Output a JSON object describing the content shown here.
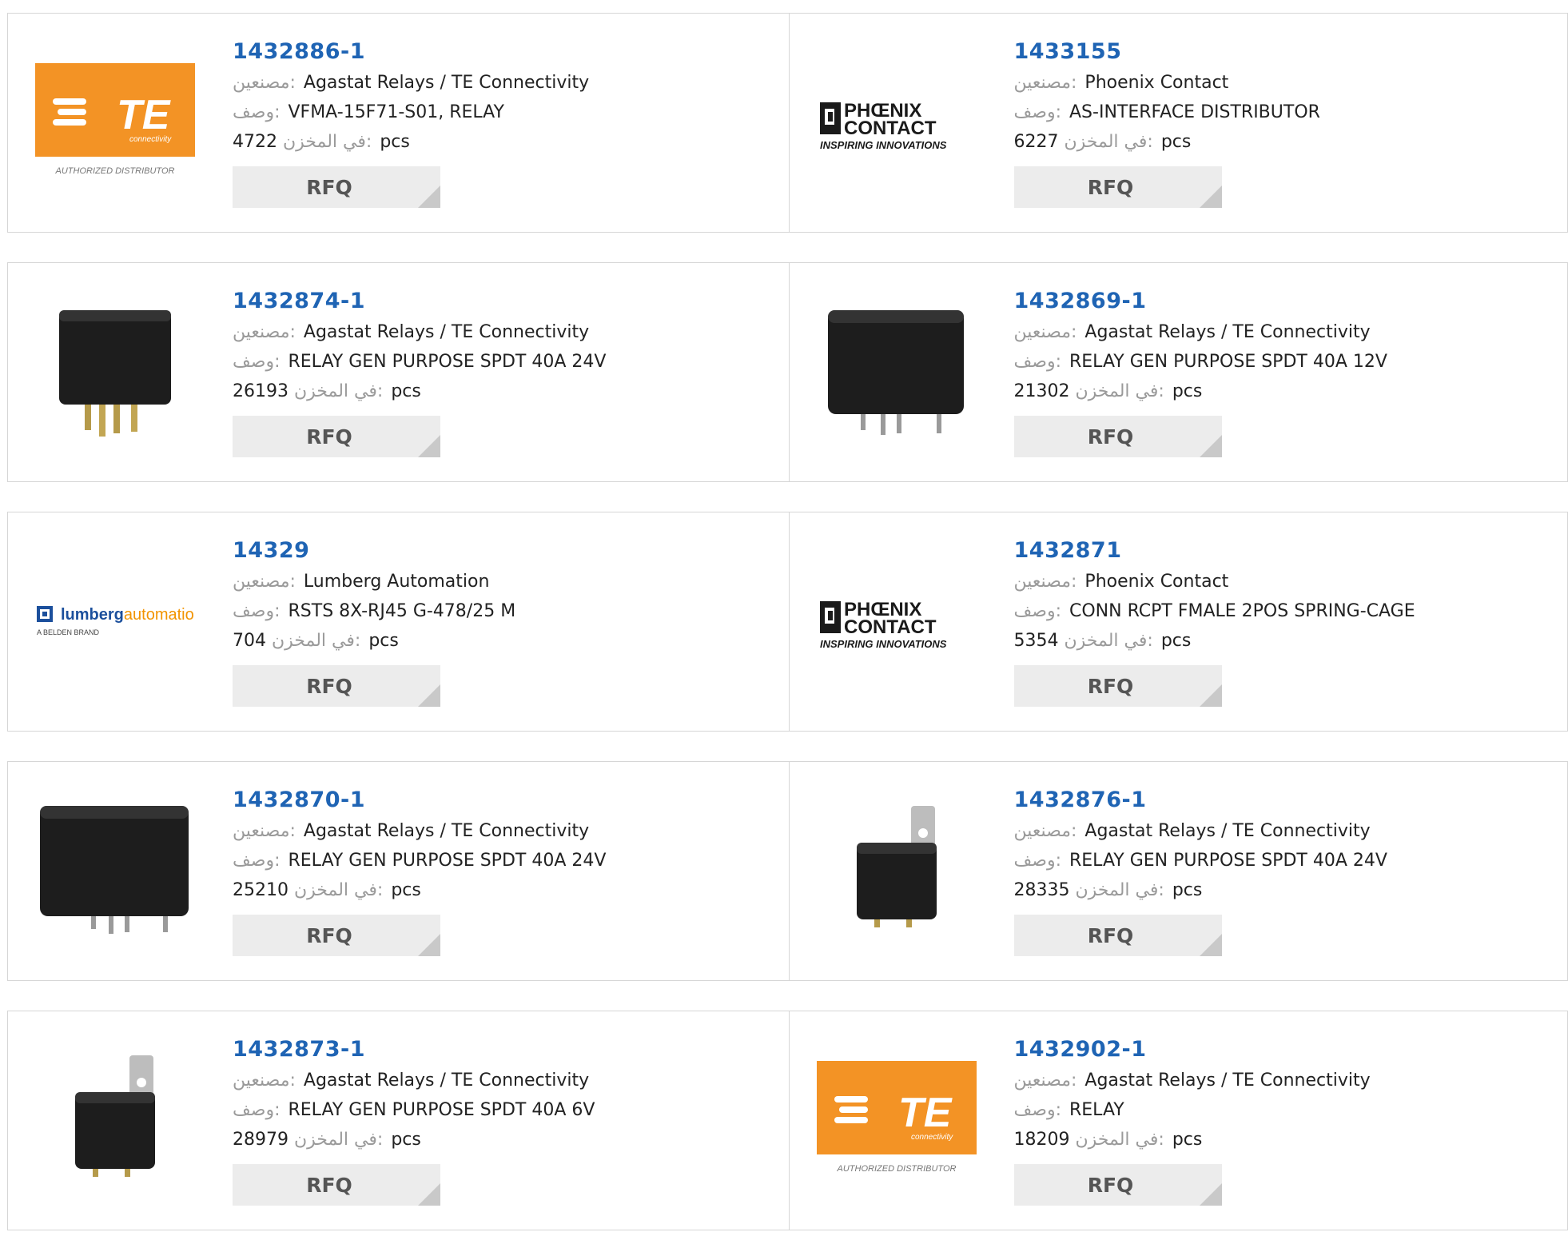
{
  "labels": {
    "manufacturer": "مصنعين:",
    "description": "وصف:",
    "stock": "في المخزن:",
    "unit": "pcs",
    "rfq": "RFQ"
  },
  "logos": {
    "te_text": "TE",
    "te_sub": "connectivity",
    "te_caption": "AUTHORIZED DISTRIBUTOR",
    "phoenix_line1": "PHŒNIX",
    "phoenix_line2": "CONTACT",
    "phoenix_tag": "INSPIRING INNOVATIONS",
    "lumberg_a": "lumberg",
    "lumberg_b": "automation",
    "lumberg_sub": "A BELDEN BRAND"
  },
  "colors": {
    "part_link": "#1f64b4",
    "te_orange": "#f39325",
    "lumberg_blue": "#1b4f9c",
    "lumberg_orange": "#f29400"
  },
  "products": [
    {
      "part": "1432886-1",
      "manufacturer": "Agastat Relays / TE Connectivity",
      "description": "VFMA-15F71-S01, RELAY",
      "stock": "4722",
      "image": "te-logo"
    },
    {
      "part": "1433155",
      "manufacturer": "Phoenix Contact",
      "description": "AS-INTERFACE DISTRIBUTOR",
      "stock": "6227",
      "image": "phoenix-logo"
    },
    {
      "part": "1432874-1",
      "manufacturer": "Agastat Relays / TE Connectivity",
      "description": "RELAY GEN PURPOSE SPDT 40A 24V",
      "stock": "26193",
      "image": "relay-photo"
    },
    {
      "part": "1432869-1",
      "manufacturer": "Agastat Relays / TE Connectivity",
      "description": "RELAY GEN PURPOSE SPDT 40A 12V",
      "stock": "21302",
      "image": "relay-photo"
    },
    {
      "part": "14329",
      "manufacturer": "Lumberg Automation",
      "description": "RSTS 8X-RJ45 G-478/25 M",
      "stock": "704",
      "image": "lumberg-logo"
    },
    {
      "part": "1432871",
      "manufacturer": "Phoenix Contact",
      "description": "CONN RCPT FMALE 2POS SPRING-CAGE",
      "stock": "5354",
      "image": "phoenix-logo"
    },
    {
      "part": "1432870-1",
      "manufacturer": "Agastat Relays / TE Connectivity",
      "description": "RELAY GEN PURPOSE SPDT 40A 24V",
      "stock": "25210",
      "image": "relay-photo"
    },
    {
      "part": "1432876-1",
      "manufacturer": "Agastat Relays / TE Connectivity",
      "description": "RELAY GEN PURPOSE SPDT 40A 24V",
      "stock": "28335",
      "image": "relay-bracket-photo"
    },
    {
      "part": "1432873-1",
      "manufacturer": "Agastat Relays / TE Connectivity",
      "description": "RELAY GEN PURPOSE SPDT 40A 6V",
      "stock": "28979",
      "image": "relay-bracket-photo"
    },
    {
      "part": "1432902-1",
      "manufacturer": "Agastat Relays / TE Connectivity",
      "description": "RELAY",
      "stock": "18209",
      "image": "te-logo"
    }
  ]
}
